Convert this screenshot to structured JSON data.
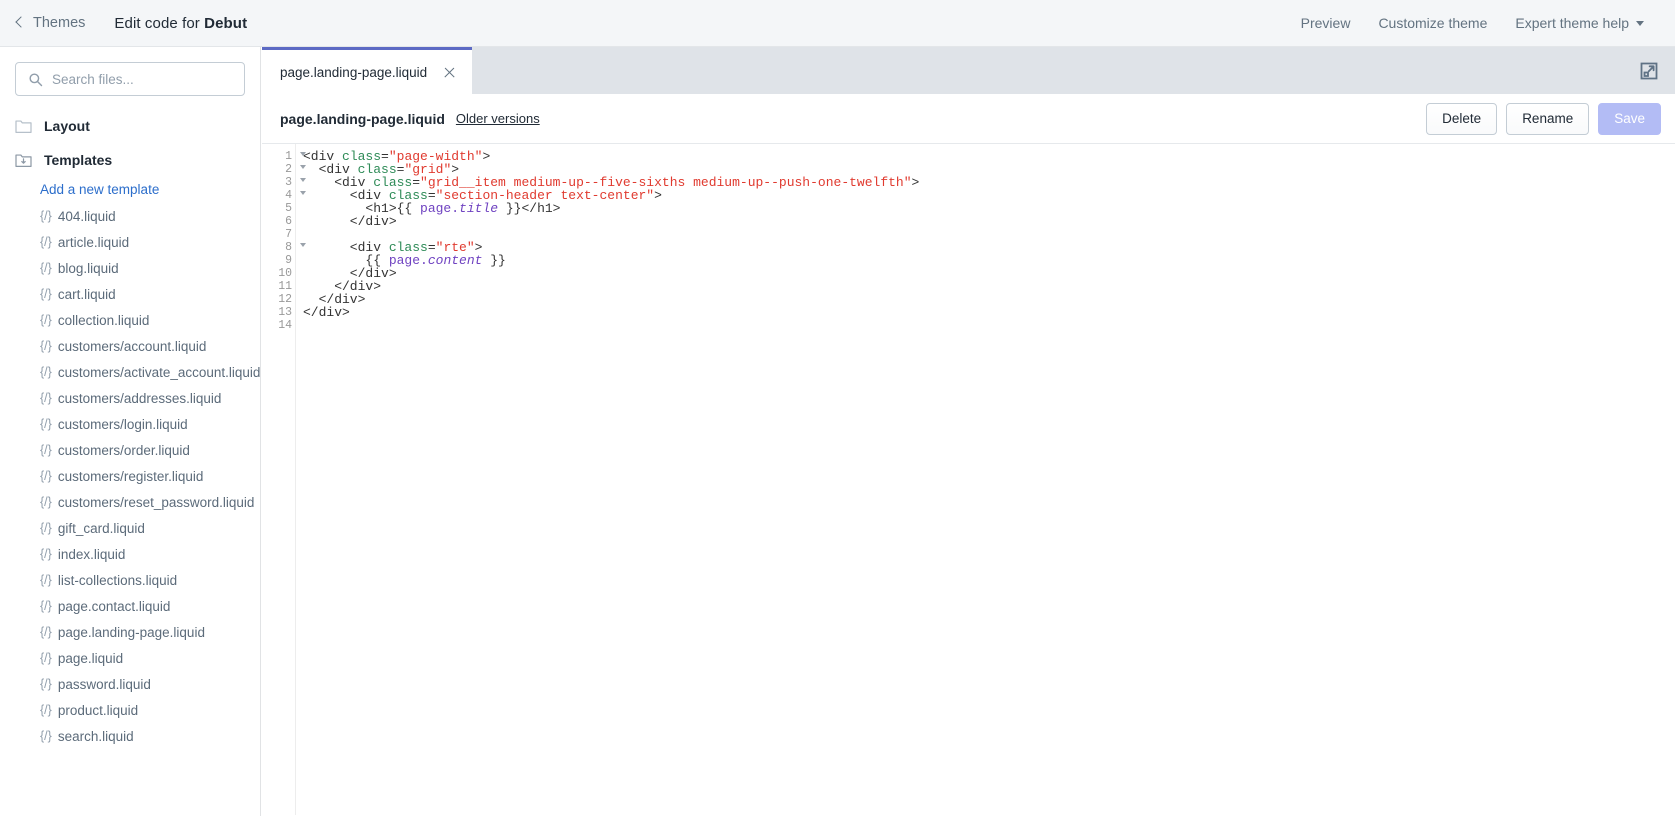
{
  "topbar": {
    "back_label": "Themes",
    "title_prefix": "Edit code for ",
    "theme_name": "Debut",
    "actions": [
      {
        "label": "Preview",
        "has_caret": false
      },
      {
        "label": "Customize theme",
        "has_caret": false
      },
      {
        "label": "Expert theme help",
        "has_caret": true
      }
    ]
  },
  "sidebar": {
    "search": {
      "value": "",
      "placeholder": "Search files..."
    },
    "folders": [
      {
        "label": "Layout",
        "icon": "folder-icon",
        "expanded": false
      },
      {
        "label": "Templates",
        "icon": "folder-open-icon",
        "expanded": true
      }
    ],
    "add_template_link": "Add a new template",
    "file_glyph": "{/}",
    "files": [
      "404.liquid",
      "article.liquid",
      "blog.liquid",
      "cart.liquid",
      "collection.liquid",
      "customers/account.liquid",
      "customers/activate_account.liquid",
      "customers/addresses.liquid",
      "customers/login.liquid",
      "customers/order.liquid",
      "customers/register.liquid",
      "customers/reset_password.liquid",
      "gift_card.liquid",
      "index.liquid",
      "list-collections.liquid",
      "page.contact.liquid",
      "page.landing-page.liquid",
      "page.liquid",
      "password.liquid",
      "product.liquid",
      "search.liquid"
    ]
  },
  "editor_panel": {
    "tabs": [
      {
        "label": "page.landing-page.liquid",
        "active": true,
        "closable": true
      }
    ],
    "expand_icon": "expand-icon",
    "file_name": "page.landing-page.liquid",
    "older_versions_label": "Older versions",
    "buttons": [
      {
        "label": "Delete",
        "style": "default",
        "disabled": false
      },
      {
        "label": "Rename",
        "style": "default",
        "disabled": false
      },
      {
        "label": "Save",
        "style": "primary",
        "disabled": true
      }
    ]
  },
  "code": {
    "line_numbers": [
      1,
      2,
      3,
      4,
      5,
      6,
      7,
      8,
      9,
      10,
      11,
      12,
      13,
      14
    ],
    "folded_lines": [
      1,
      2,
      3,
      4,
      8
    ],
    "lines": [
      [
        {
          "t": "tag",
          "s": "<div "
        },
        {
          "t": "attr",
          "s": "class"
        },
        {
          "t": "tag",
          "s": "="
        },
        {
          "t": "val",
          "s": "\"page-width\""
        },
        {
          "t": "tag",
          "s": ">"
        }
      ],
      [
        {
          "t": "tag",
          "s": "  <div "
        },
        {
          "t": "attr",
          "s": "class"
        },
        {
          "t": "tag",
          "s": "="
        },
        {
          "t": "val",
          "s": "\"grid\""
        },
        {
          "t": "tag",
          "s": ">"
        }
      ],
      [
        {
          "t": "tag",
          "s": "    <div "
        },
        {
          "t": "attr",
          "s": "class"
        },
        {
          "t": "tag",
          "s": "="
        },
        {
          "t": "val",
          "s": "\"grid__item medium-up--five-sixths medium-up--push-one-twelfth\""
        },
        {
          "t": "tag",
          "s": ">"
        }
      ],
      [
        {
          "t": "tag",
          "s": "      <div "
        },
        {
          "t": "attr",
          "s": "class"
        },
        {
          "t": "tag",
          "s": "="
        },
        {
          "t": "val",
          "s": "\"section-header text-center\""
        },
        {
          "t": "tag",
          "s": ">"
        }
      ],
      [
        {
          "t": "tag",
          "s": "        <h1>{{ "
        },
        {
          "t": "liq",
          "s": "page."
        },
        {
          "t": "liq-i",
          "s": "title"
        },
        {
          "t": "tag",
          "s": " }}</h1>"
        }
      ],
      [
        {
          "t": "tag",
          "s": "      </div>"
        }
      ],
      [
        {
          "t": "plain",
          "s": ""
        }
      ],
      [
        {
          "t": "tag",
          "s": "      <div "
        },
        {
          "t": "attr",
          "s": "class"
        },
        {
          "t": "tag",
          "s": "="
        },
        {
          "t": "val",
          "s": "\"rte\""
        },
        {
          "t": "tag",
          "s": ">"
        }
      ],
      [
        {
          "t": "tag",
          "s": "        {{ "
        },
        {
          "t": "liq",
          "s": "page."
        },
        {
          "t": "liq-i",
          "s": "content"
        },
        {
          "t": "tag",
          "s": " }}"
        }
      ],
      [
        {
          "t": "tag",
          "s": "      </div>"
        }
      ],
      [
        {
          "t": "tag",
          "s": "    </div>"
        }
      ],
      [
        {
          "t": "tag",
          "s": "  </div>"
        }
      ],
      [
        {
          "t": "tag",
          "s": "</div>"
        }
      ],
      [
        {
          "t": "plain",
          "s": ""
        }
      ]
    ]
  },
  "colors": {
    "accent_indigo": "#5c6ac4",
    "link_blue": "#2c6ecb",
    "text_dark": "#212b36",
    "text_subdued": "#637381",
    "tabbar_bg": "#dfe3e8",
    "topbar_bg": "#f4f6f8",
    "save_disabled": "#b3bcf5"
  }
}
